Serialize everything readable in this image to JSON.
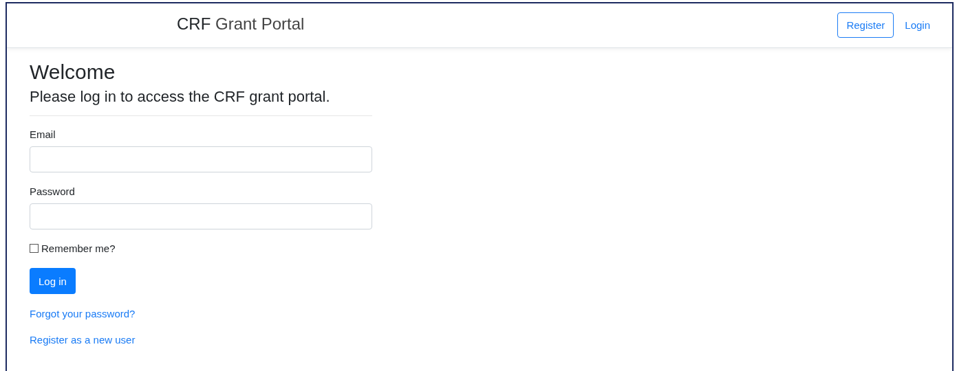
{
  "navbar": {
    "brand": {
      "lead": "CRF",
      "rest": "Grant Portal"
    },
    "links": [
      {
        "label": "Register",
        "kind": "outline"
      },
      {
        "label": "Login",
        "kind": "plain"
      }
    ]
  },
  "heading": "Welcome",
  "subheading": "Please log in to access the CRF grant portal.",
  "form": {
    "fields": [
      {
        "label": "Email"
      },
      {
        "label": "Password"
      }
    ],
    "remember": {
      "label": "Remember me?",
      "checked": false
    },
    "submit": "Log in"
  },
  "links": [
    "Forgot your password?",
    "Register as a new user"
  ]
}
